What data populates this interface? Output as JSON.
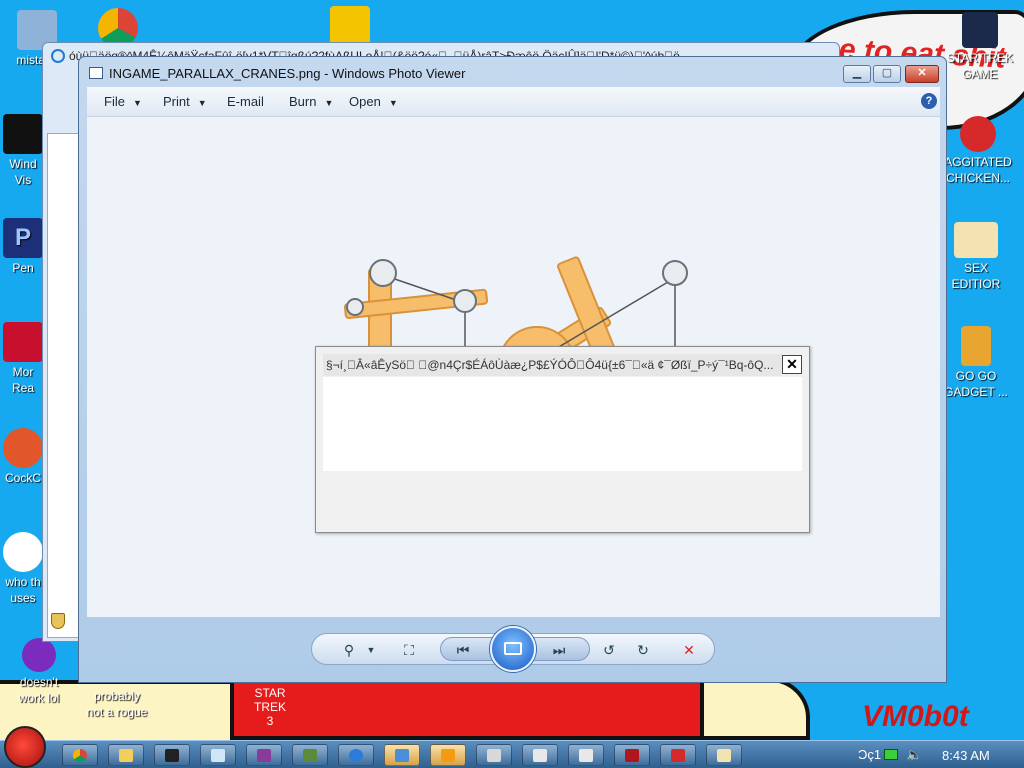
{
  "wallpaper": {
    "banner_text": "e to eat shit\nhew",
    "signature": "VM0b0t",
    "bottom_label": "STAR TREK\n3"
  },
  "desktop_icons_left": [
    {
      "label": "mistake",
      "color": "#6b8fb5"
    },
    {
      "label": "Windows Vista",
      "display": "Wind\nVis",
      "color": "#111111"
    },
    {
      "label": "Premiere",
      "display": "Pen",
      "color": "#1e2f7a"
    },
    {
      "label": "Adobe Reader",
      "display": "Mor\nRea",
      "color": "#c8102e"
    },
    {
      "label": "CockCC",
      "display": "CockC",
      "color": "#e2562b"
    },
    {
      "label": "who th uses",
      "display": "who th\nuses",
      "color": "#ffffff"
    },
    {
      "label": "doesn't work lol",
      "display": "doesn't\nwork lol",
      "color": "#7b2cbf"
    }
  ],
  "desktop_icons_bottom": [
    {
      "label": "probably\nnot a rogue"
    }
  ],
  "desktop_icons_right": [
    {
      "label": "STAR TREK\nGAME",
      "color": "#1b2a4a"
    },
    {
      "label": "AGGITATED\nCHICKEN...",
      "color": "#d62a2a"
    },
    {
      "label": "SEX\nEDITIOR",
      "color": "#f3e3b0"
    },
    {
      "label": "GO GO\nGADGET ...",
      "color": "#e8a530"
    }
  ],
  "background_window": {
    "title": "óùü\u0000äöq®^M4Ê¼êMäŸçfaFûî-ë[y1*VT\u0000îqßú?2fùAßULoÅ!\u0000(&ëö?é«\u0000_\u0000üÅ)râT>Ðæêö,ÖäcIÛ]ä\u0000I'D*ü©)\u0000'^úb\u0000ö..."
  },
  "viewer": {
    "title": "INGAME_PARALLAX_CRANES.png - Windows Photo Viewer",
    "menu": [
      "File",
      "Print",
      "E-mail",
      "Burn",
      "Open"
    ],
    "menu_has_arrow": [
      true,
      true,
      false,
      true,
      true
    ],
    "help_label": "?"
  },
  "dialog": {
    "title": "§¬í¸\u0000Â«âÊySö\u0000 \u0000@n4Çr$ÉÁôÙàæ¿P$£ÝÓÔ\u0000Ô4ü{±6¯\u0000«ä ¢¯Øßï_P÷ý¯¹Bq-ôQ...",
    "close_label": "✕"
  },
  "taskbar": {
    "clock": "8:43 AM",
    "lang": "Ͻç1",
    "items": [
      "chrome",
      "folder",
      "7zip",
      "notepad",
      "winrar",
      "minecraft",
      "ie",
      "photo-viewer",
      "media-player",
      "paint",
      "window1",
      "window2",
      "filezilla",
      "angry-birds",
      "hxd"
    ]
  }
}
